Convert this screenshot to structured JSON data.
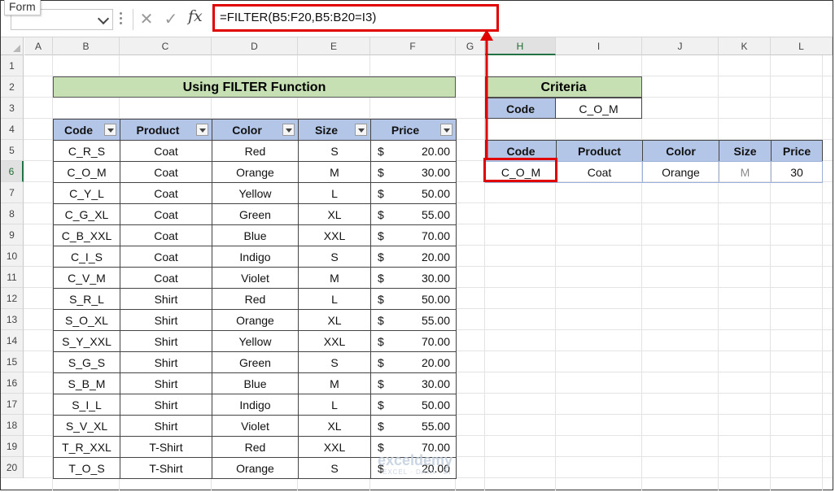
{
  "formula_bar": {
    "name_box": "",
    "name_tooltip": "Form",
    "cancel_icon": "close-icon",
    "enter_icon": "checkmark-icon",
    "fx_label": "fx",
    "formula": "=FILTER(B5:F20,B5:B20=I3)"
  },
  "columns": [
    "A",
    "B",
    "C",
    "D",
    "E",
    "F",
    "G",
    "H",
    "I",
    "J",
    "K",
    "L"
  ],
  "rows": [
    "1",
    "2",
    "3",
    "4",
    "5",
    "6",
    "7",
    "8",
    "9",
    "10",
    "11",
    "12",
    "13",
    "14",
    "15",
    "16",
    "17",
    "18",
    "19",
    "20"
  ],
  "selected_column": "H",
  "selected_row": "6",
  "main_table": {
    "title": "Using FILTER Function",
    "headers": [
      "Code",
      "Product",
      "Color",
      "Size",
      "Price"
    ],
    "currency_symbol": "$",
    "rows": [
      [
        "C_R_S",
        "Coat",
        "Red",
        "S",
        "20.00"
      ],
      [
        "C_O_M",
        "Coat",
        "Orange",
        "M",
        "30.00"
      ],
      [
        "C_Y_L",
        "Coat",
        "Yellow",
        "L",
        "50.00"
      ],
      [
        "C_G_XL",
        "Coat",
        "Green",
        "XL",
        "55.00"
      ],
      [
        "C_B_XXL",
        "Coat",
        "Blue",
        "XXL",
        "70.00"
      ],
      [
        "C_I_S",
        "Coat",
        "Indigo",
        "S",
        "20.00"
      ],
      [
        "C_V_M",
        "Coat",
        "Violet",
        "M",
        "30.00"
      ],
      [
        "S_R_L",
        "Shirt",
        "Red",
        "L",
        "50.00"
      ],
      [
        "S_O_XL",
        "Shirt",
        "Orange",
        "XL",
        "55.00"
      ],
      [
        "S_Y_XXL",
        "Shirt",
        "Yellow",
        "XXL",
        "70.00"
      ],
      [
        "S_G_S",
        "Shirt",
        "Green",
        "S",
        "20.00"
      ],
      [
        "S_B_M",
        "Shirt",
        "Blue",
        "M",
        "30.00"
      ],
      [
        "S_I_L",
        "Shirt",
        "Indigo",
        "L",
        "50.00"
      ],
      [
        "S_V_XL",
        "Shirt",
        "Violet",
        "XL",
        "55.00"
      ],
      [
        "T_R_XXL",
        "T-Shirt",
        "Red",
        "XXL",
        "70.00"
      ],
      [
        "T_O_S",
        "T-Shirt",
        "Orange",
        "S",
        "20.00"
      ]
    ]
  },
  "criteria": {
    "title": "Criteria",
    "label": "Code",
    "value": "C_O_M"
  },
  "result_table": {
    "headers": [
      "Code",
      "Product",
      "Color",
      "Size",
      "Price"
    ],
    "row": [
      "C_O_M",
      "Coat",
      "Orange",
      "M",
      "30"
    ]
  },
  "watermark": {
    "name": "exceldemy",
    "tagline": "EXCEL · DATA · BI"
  },
  "colors": {
    "title_fill": "#c6e0b4",
    "header_fill": "#b4c6e7",
    "highlight": "#e00000",
    "excel_green": "#217346"
  }
}
